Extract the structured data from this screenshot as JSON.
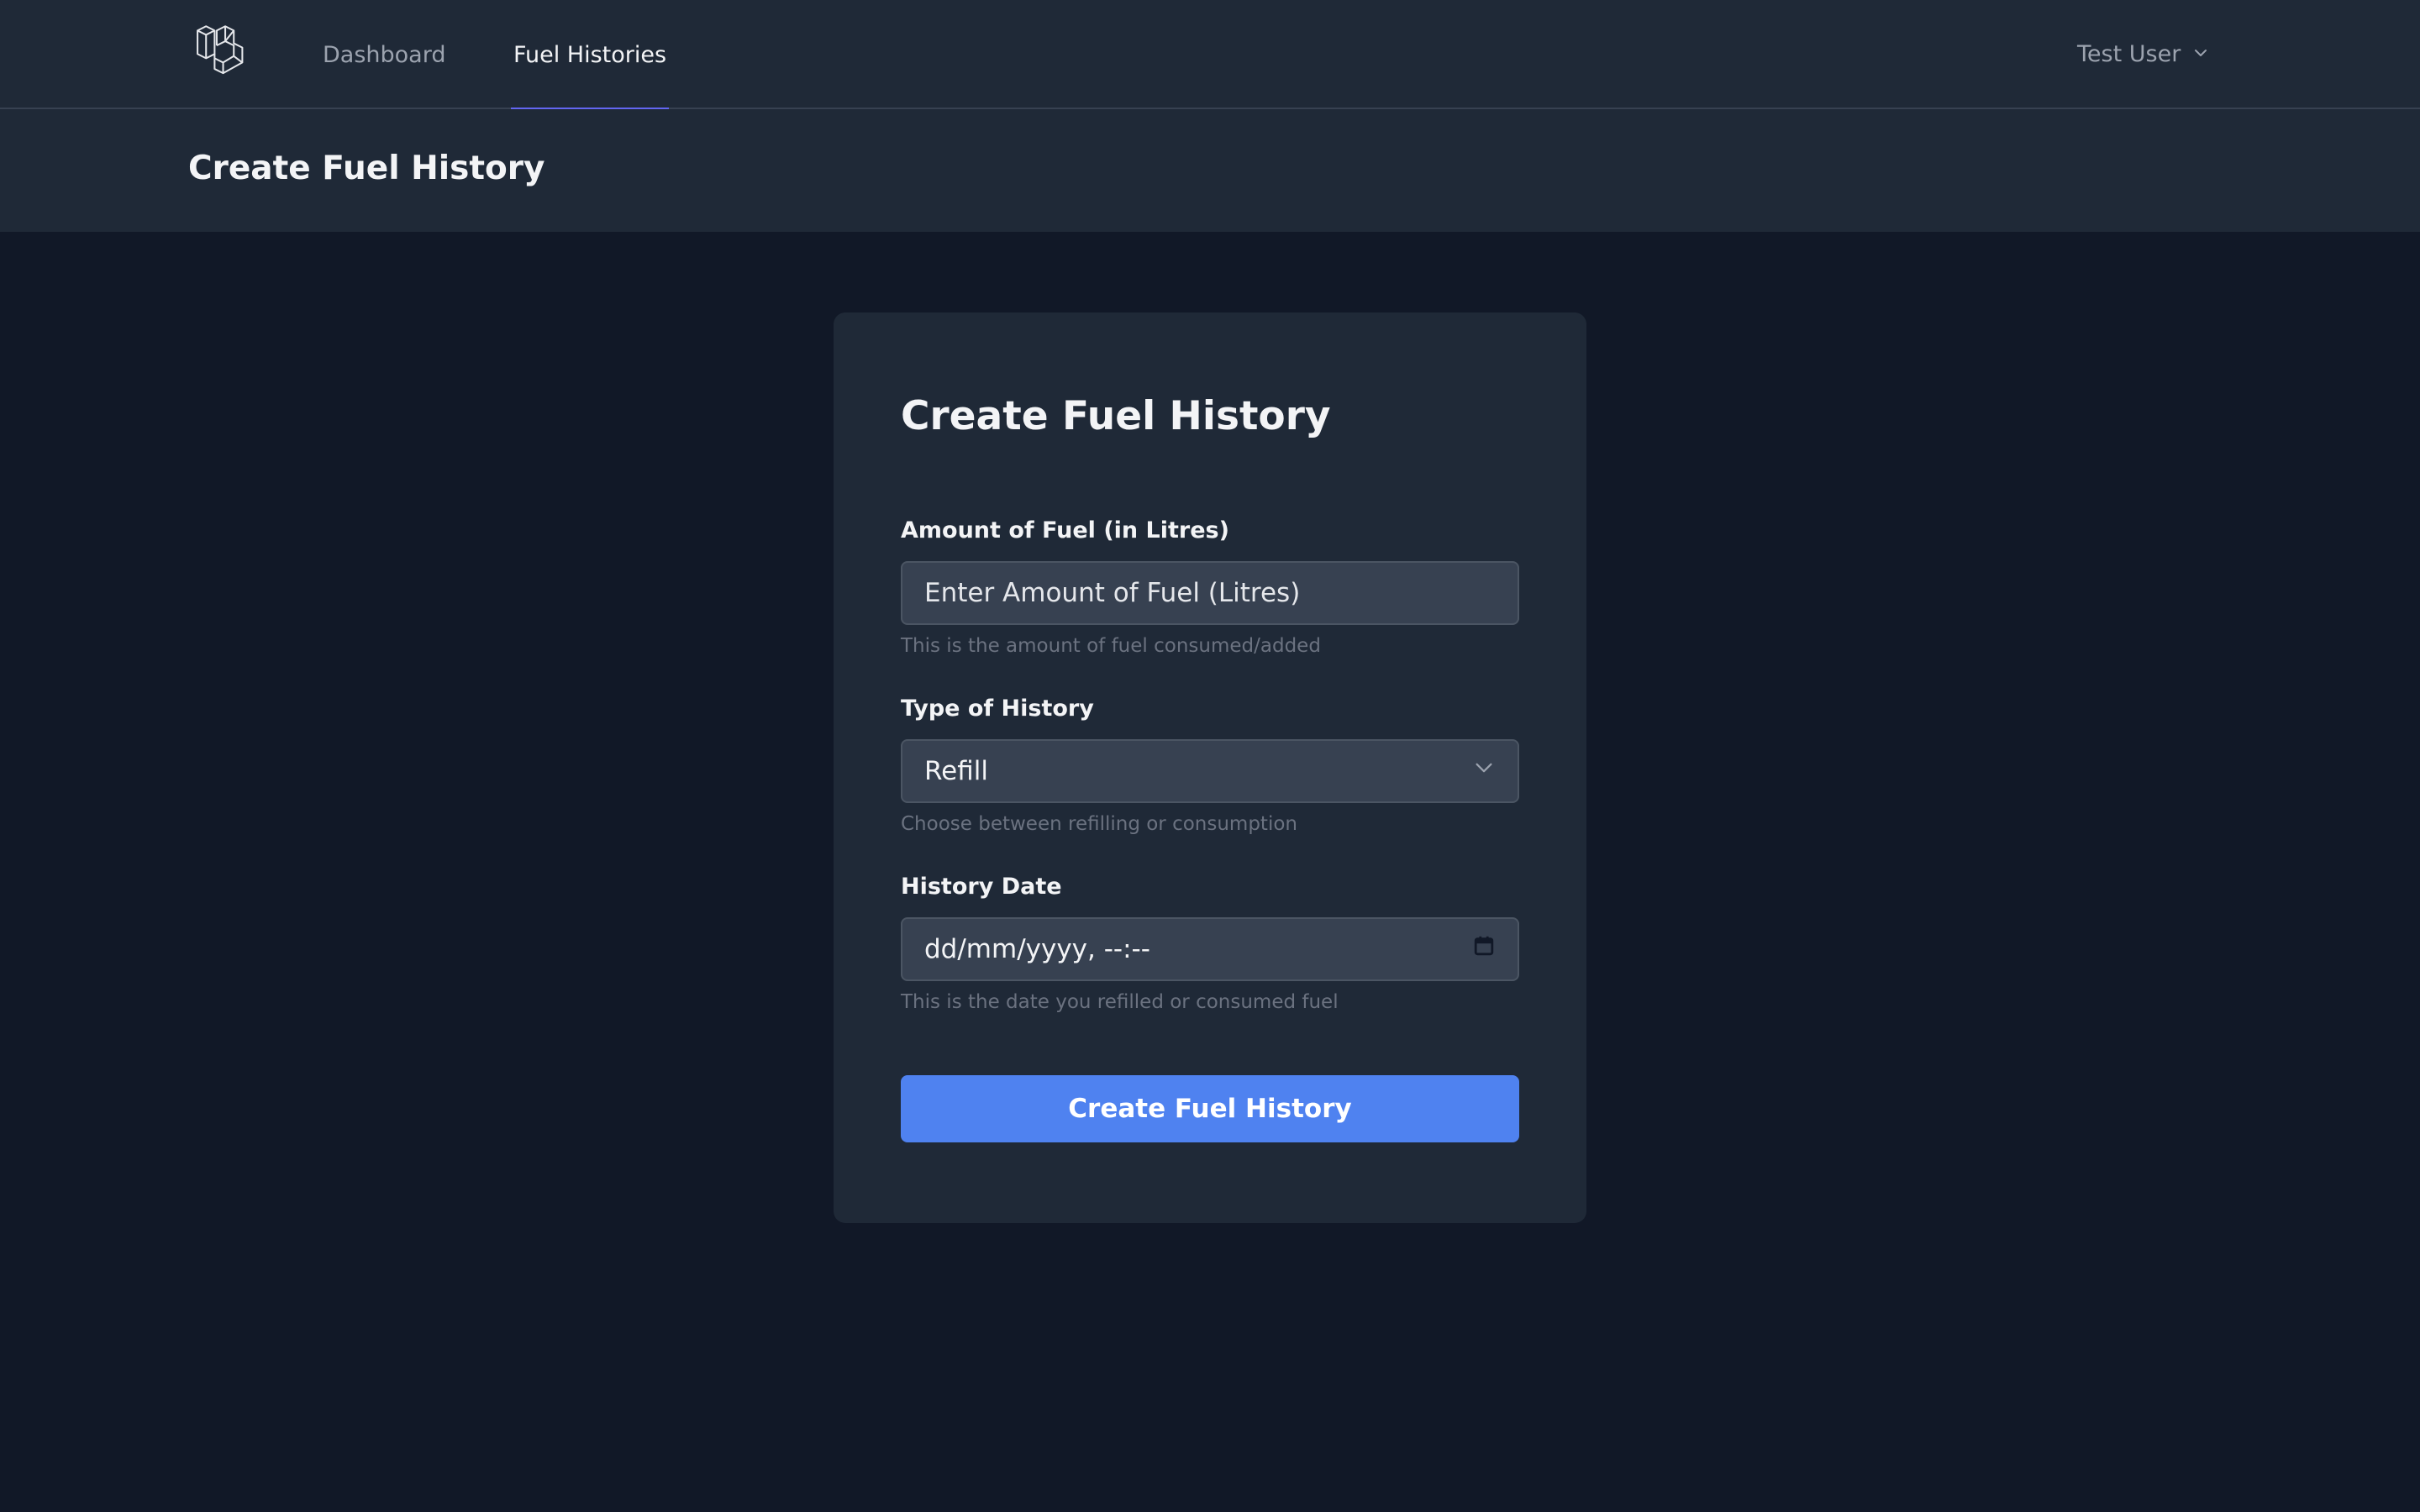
{
  "nav": {
    "logo_icon": "laravel-logo-icon",
    "links": [
      {
        "label": "Dashboard",
        "active": false
      },
      {
        "label": "Fuel Histories",
        "active": true
      }
    ],
    "user": {
      "name": "Test User",
      "icon": "chevron-down-icon"
    },
    "active_color": "#6366f1"
  },
  "header": {
    "title": "Create Fuel History"
  },
  "form": {
    "title": "Create Fuel History",
    "amount": {
      "label": "Amount of Fuel (in Litres)",
      "placeholder": "Enter Amount of Fuel (Litres)",
      "value": "",
      "help": "This is the amount of fuel consumed/added"
    },
    "type": {
      "label": "Type of History",
      "selected": "Refill",
      "help": "Choose between refilling or consumption",
      "icon": "chevron-down-icon"
    },
    "date": {
      "label": "History Date",
      "placeholder": "dd/mm/yyyy, --:--",
      "help": "This is the date you refilled or consumed fuel",
      "icon": "calendar-icon"
    },
    "submit_label": "Create Fuel History",
    "submit_color": "#4f82f0"
  }
}
